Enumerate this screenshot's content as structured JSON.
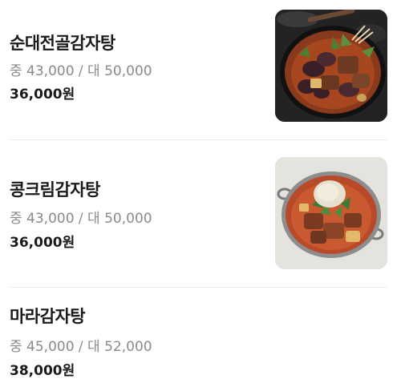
{
  "menu": {
    "items": [
      {
        "name": "순대전골감자탕",
        "sizes": "중 43,000 / 대 50,000",
        "price": "36,000원",
        "image": "sundae-jeongol-gamjatang-photo"
      },
      {
        "name": "콩크림감자탕",
        "sizes": "중 43,000 / 대 50,000",
        "price": "36,000원",
        "image": "kong-cream-gamjatang-photo"
      },
      {
        "name": "마라감자탕",
        "sizes": "중 45,000 / 대 52,000",
        "price": "38,000원"
      }
    ]
  }
}
